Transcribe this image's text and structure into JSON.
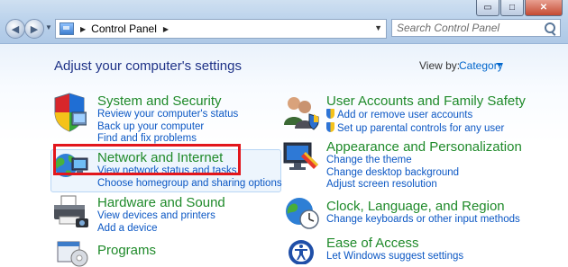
{
  "window": {
    "minimize_glyph": "▭",
    "maximize_glyph": "□",
    "close_glyph": "✕"
  },
  "nav": {
    "back_glyph": "◀",
    "forward_glyph": "▶",
    "recent_glyph": "▼"
  },
  "address": {
    "crumb_separator": "▶",
    "crumb": "Control Panel",
    "crumb_end_separator": "▶",
    "dropdown_glyph": "▼"
  },
  "search": {
    "placeholder": "Search Control Panel"
  },
  "content": {
    "heading": "Adjust your computer's settings",
    "view_by_label": "View by:",
    "view_by_value": "Category"
  },
  "categories_left": [
    {
      "title": "System and Security",
      "icon": "shield-icon",
      "links": [
        "Review your computer's status",
        "Back up your computer",
        "Find and fix problems"
      ]
    },
    {
      "title": "Network and Internet",
      "icon": "network-globe-icon",
      "links": [
        "View network status and tasks",
        "Choose homegroup and sharing options"
      ]
    },
    {
      "title": "Hardware and Sound",
      "icon": "printer-icon",
      "links": [
        "View devices and printers",
        "Add a device"
      ]
    },
    {
      "title": "Programs",
      "icon": "programs-icon",
      "links": []
    }
  ],
  "categories_right": [
    {
      "title": "User Accounts and Family Safety",
      "icon": "users-icon",
      "links": [
        "Add or remove user accounts",
        "Set up parental controls for any user"
      ]
    },
    {
      "title": "Appearance and Personalization",
      "icon": "monitor-icon",
      "links": [
        "Change the theme",
        "Change desktop background",
        "Adjust screen resolution"
      ]
    },
    {
      "title": "Clock, Language, and Region",
      "icon": "clock-globe-icon",
      "links": [
        "Change keyboards or other input methods"
      ]
    },
    {
      "title": "Ease of Access",
      "icon": "ease-of-access-icon",
      "links": [
        "Let Windows suggest settings"
      ]
    }
  ],
  "colors": {
    "category_title": "#1f8a2a",
    "link": "#0b57c4",
    "heading": "#1e3287",
    "highlight_box": "#e2161c"
  }
}
